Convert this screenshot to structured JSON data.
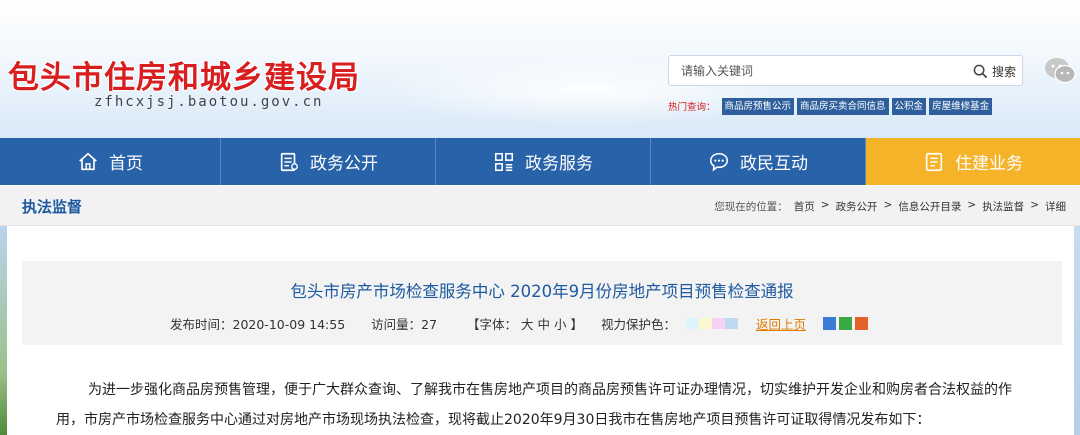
{
  "header": {
    "site_title": "包头市住房和城乡建设局",
    "site_url": "zfhcxjsj.baotou.gov.cn",
    "search": {
      "placeholder": "请输入关键词",
      "button_label": "搜索"
    },
    "hot": {
      "label": "热门查询：",
      "links": [
        "商品房预售公示",
        "商品房买卖合同信息",
        "公积金",
        "房屋维修基金"
      ]
    }
  },
  "nav": {
    "items": [
      {
        "label": "首页",
        "icon": "home-icon"
      },
      {
        "label": "政务公开",
        "icon": "document-icon"
      },
      {
        "label": "政务服务",
        "icon": "grid-icon"
      },
      {
        "label": "政民互动",
        "icon": "chat-icon"
      },
      {
        "label": "住建业务",
        "icon": "folder-icon"
      }
    ],
    "active_index": 4,
    "colors": {
      "bar": "#2862a8",
      "active": "#f5b32a"
    }
  },
  "section": {
    "title": "执法监督",
    "breadcrumb_label": "您现在的位置：",
    "breadcrumb": [
      "首页",
      "政务公开",
      "信息公开目录",
      "执法监督",
      "详细"
    ],
    "separator": ">"
  },
  "article": {
    "title": "包头市房产市场检查服务中心 2020年9月份房地产项目预售检查通报",
    "publish_time": "发布时间：2020-10-09 14:55",
    "views": "访问量：27",
    "font_size": "【字体： 大  中  小 】",
    "eye_care": "视力保护色：",
    "eye_colors": [
      "#ddf4fb",
      "#fbf7cf",
      "#f6d1f4",
      "#bcd8f2"
    ],
    "back": "返回上页",
    "body": "为进一步强化商品房预售管理，便于广大群众查询、了解我市在售房地产项目的商品房预售许可证办理情况，切实维护开发企业和购房者合法权益的作用，市房产市场检查服务中心通过对房地产市场现场执法检查，现将截止2020年9月30日我市在售房地产项目预售许可证取得情况发布如下："
  }
}
